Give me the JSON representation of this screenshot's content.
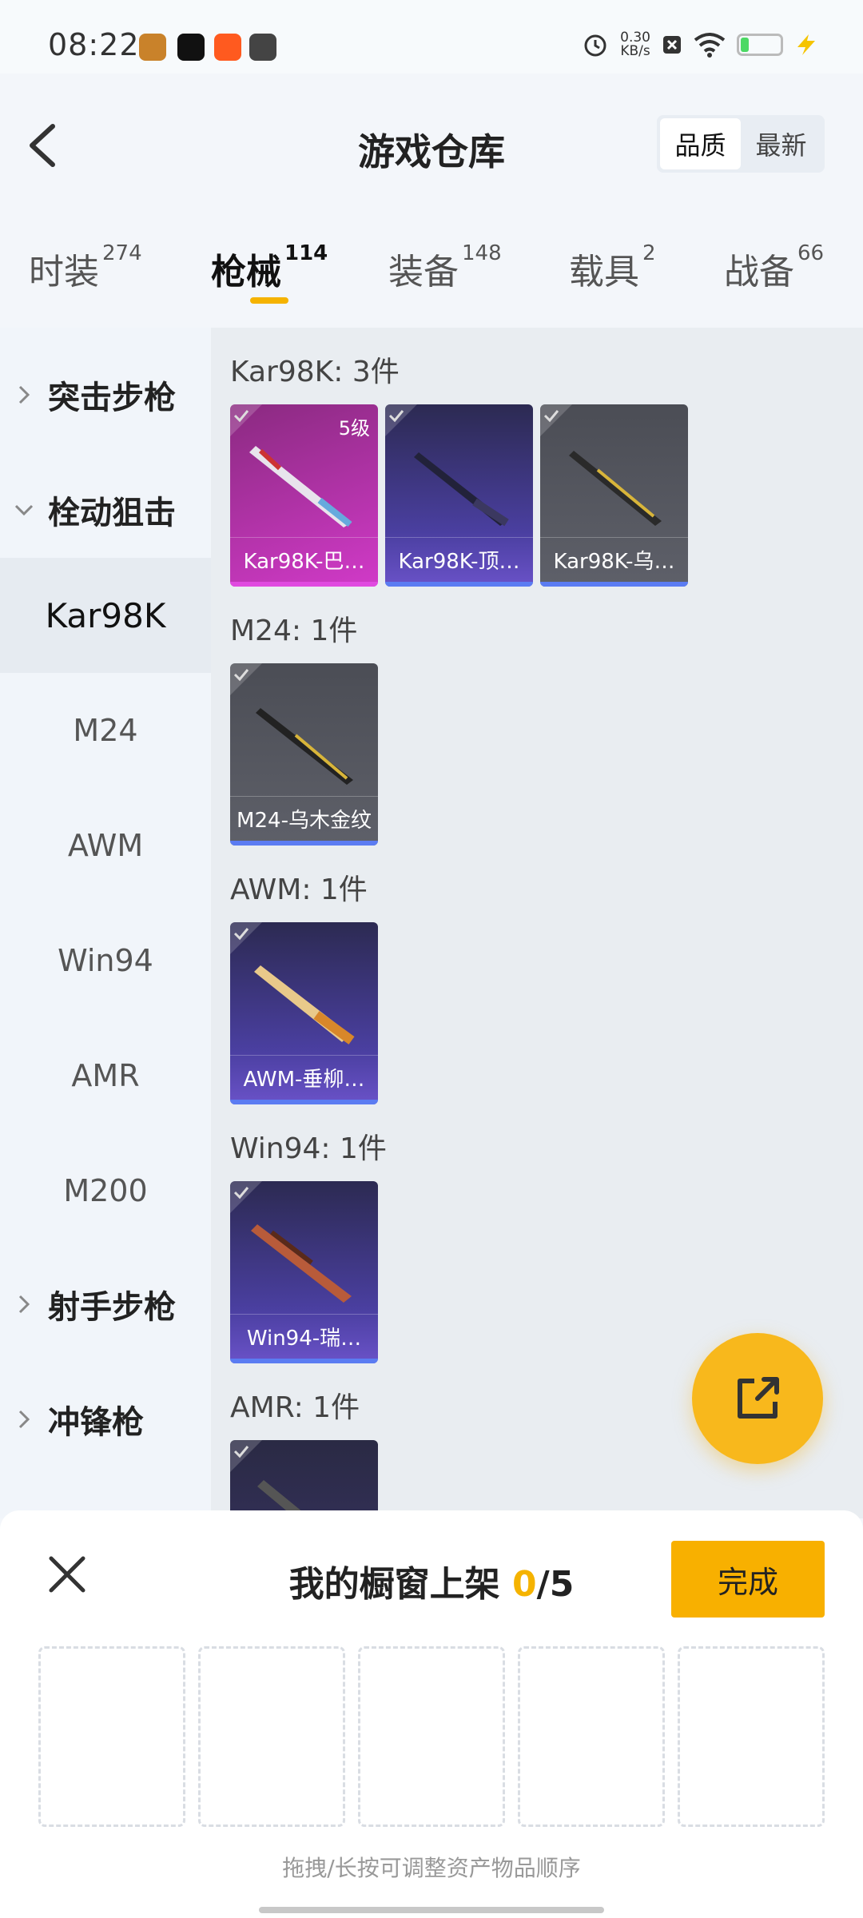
{
  "status_bar": {
    "time": "08:22",
    "net_speed": "0.30",
    "net_unit": "KB/s"
  },
  "header": {
    "title": "游戏仓库",
    "sort": [
      "品质",
      "最新"
    ]
  },
  "tabs": [
    {
      "label": "时装",
      "count": "274"
    },
    {
      "label": "枪械",
      "count": "114"
    },
    {
      "label": "装备",
      "count": "148"
    },
    {
      "label": "载具",
      "count": "2"
    },
    {
      "label": "战备",
      "count": "66"
    }
  ],
  "sidebar": {
    "items": [
      "突击步枪",
      "栓动狙击",
      "Kar98K",
      "M24",
      "AWM",
      "Win94",
      "AMR",
      "M200",
      "射手步枪",
      "冲锋枪"
    ]
  },
  "groups": [
    {
      "title": "Kar98K: 3件",
      "items": [
        {
          "name": "Kar98K-巴…",
          "level": "5级",
          "color": "pink"
        },
        {
          "name": "Kar98K-顶…",
          "color": "purple"
        },
        {
          "name": "Kar98K-乌…",
          "color": "gray"
        }
      ]
    },
    {
      "title": "M24: 1件",
      "items": [
        {
          "name": "M24-乌木金纹",
          "color": "gray"
        }
      ]
    },
    {
      "title": "AWM: 1件",
      "items": [
        {
          "name": "AWM-垂柳…",
          "color": "purple"
        }
      ]
    },
    {
      "title": "Win94: 1件",
      "items": [
        {
          "name": "Win94-瑞…",
          "color": "purple"
        }
      ]
    },
    {
      "title": "AMR: 1件",
      "items": [
        {
          "name": "",
          "color": "purple"
        }
      ]
    }
  ],
  "sheet": {
    "title_prefix": "我的橱窗上架",
    "current": "0",
    "total": "/5",
    "done_label": "完成",
    "hint": "拖拽/长按可调整资产物品顺序"
  }
}
